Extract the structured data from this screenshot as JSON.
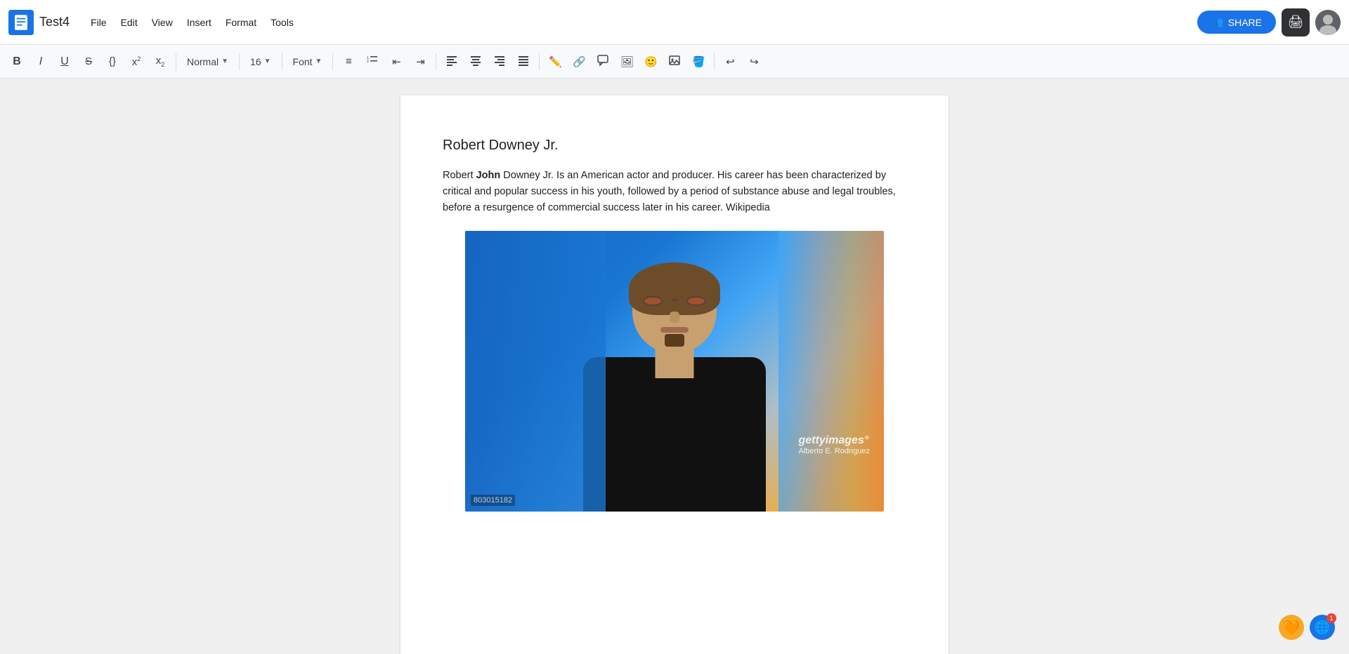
{
  "app": {
    "title": "Test4",
    "doc_icon_color": "#1a73e8"
  },
  "menu": {
    "items": [
      "File",
      "Edit",
      "View",
      "Insert",
      "Format",
      "Tools"
    ]
  },
  "topbar": {
    "share_label": "SHARE",
    "share_icon": "👥"
  },
  "toolbar": {
    "bold_label": "B",
    "italic_label": "I",
    "underline_label": "U",
    "strikethrough_label": "S",
    "braces_label": "{}",
    "superscript_label": "x²",
    "subscript_label": "x₂",
    "style_value": "Normal",
    "font_size_value": "16",
    "font_value": "Font",
    "undo_label": "↩",
    "redo_label": "↪"
  },
  "document": {
    "heading": "Robert Downey Jr.",
    "body_prefix": "Robert ",
    "body_bold": "John",
    "body_suffix": " Downey Jr. Is an American actor and producer. His career has been characterized by critical and popular success in his youth, followed by a period of substance abuse and legal troubles, before a resurgence of commercial success later in his career. Wikipedia",
    "image": {
      "getty_logo": "gettyimages°",
      "photographer": "Alberto E. Rodriguez",
      "image_number": "803015182"
    }
  },
  "badges": {
    "emoji": "🧡",
    "notification_count": "1",
    "notification_icon": "🌐"
  }
}
